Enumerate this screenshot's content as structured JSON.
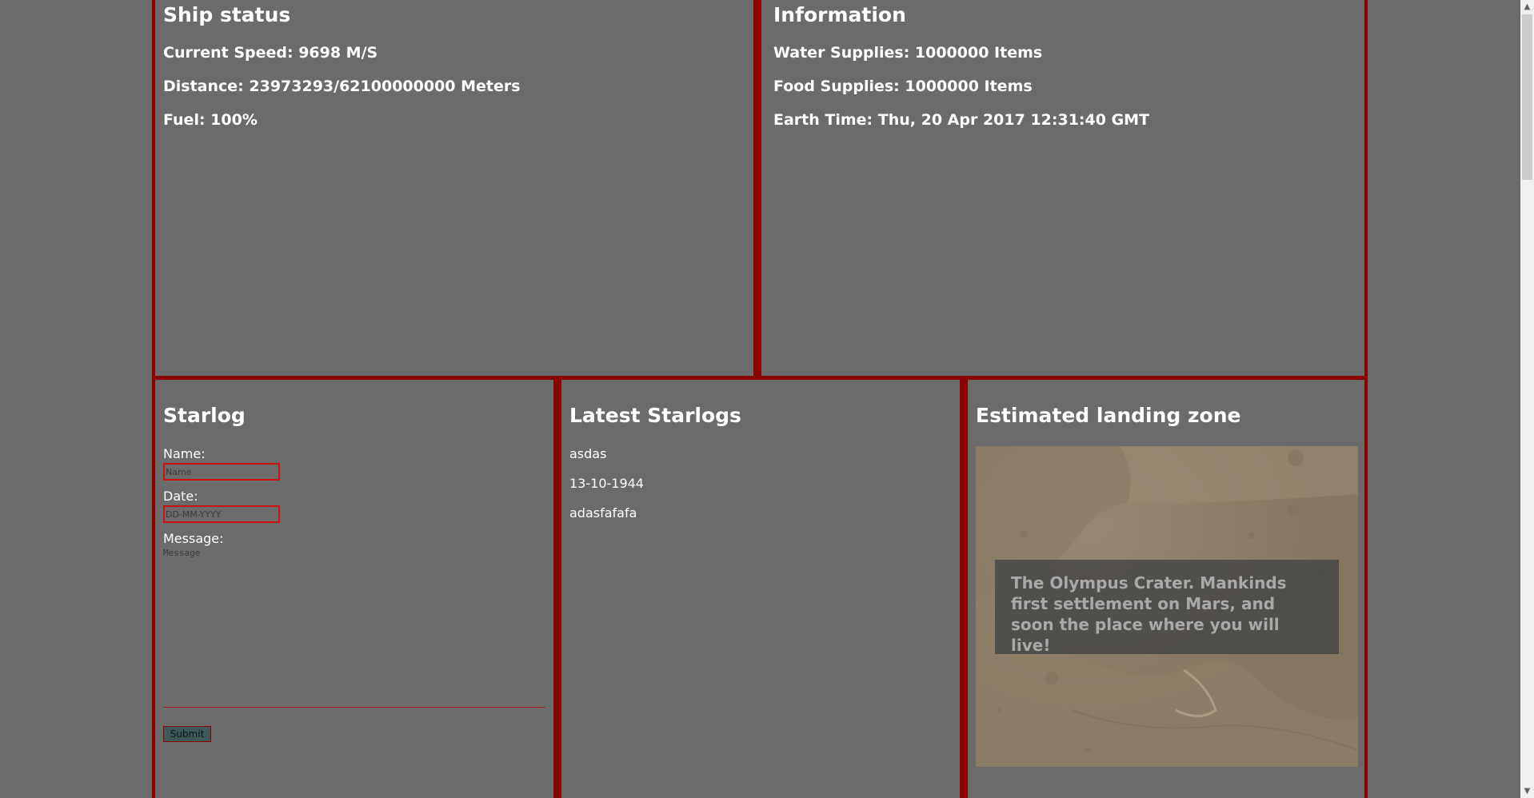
{
  "ship_status": {
    "title": "Ship status",
    "speed": "Current Speed: 9698 M/S",
    "distance": "Distance: 23973293/62100000000 Meters",
    "fuel": "Fuel: 100%"
  },
  "information": {
    "title": "Information",
    "water": "Water Supplies: 1000000 Items",
    "food": "Food Supplies: 1000000 Items",
    "earth_time": "Earth Time: Thu, 20 Apr 2017 12:31:40 GMT"
  },
  "starlog_form": {
    "title": "Starlog",
    "name_label": "Name:",
    "name_placeholder": "Name",
    "date_label": "Date:",
    "date_placeholder": "DD-MM-YYYY",
    "message_label": "Message:",
    "message_placeholder": "Message",
    "submit_label": "Submit"
  },
  "latest_starlogs": {
    "title": "Latest Starlogs",
    "entries": [
      "asdas",
      "13-10-1944",
      "adasfafafa"
    ]
  },
  "landing_zone": {
    "title": "Estimated landing zone",
    "caption": "The Olympus Crater. Mankinds first settlement on Mars, and soon the place where you will live!"
  },
  "colors": {
    "background": "#6b6b6b",
    "border_accent": "#8b0000",
    "input_border": "#cc1111",
    "submit_bg": "#3e5a5a"
  },
  "icons": {
    "scroll_up": "chevron-up-icon",
    "scroll_down": "chevron-down-icon"
  }
}
